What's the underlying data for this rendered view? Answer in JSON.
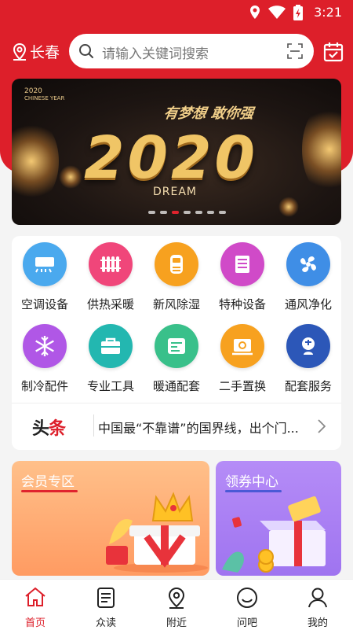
{
  "status": {
    "time": "3:21"
  },
  "header": {
    "location": "长春",
    "search_placeholder": "请输入关键词搜索"
  },
  "banner": {
    "year_tag": "2020",
    "year_sub": "CHINESE YEAR",
    "slogan": "有梦想 敢你强",
    "year_big": "2020",
    "dream": "DREAM",
    "slide_count": 7,
    "active_slide": 3
  },
  "categories": [
    {
      "label": "空调设备",
      "icon": "air-conditioner-icon",
      "color": "#4aa9ee"
    },
    {
      "label": "供热采暖",
      "icon": "radiator-icon",
      "color": "#f0467a"
    },
    {
      "label": "新风除湿",
      "icon": "dehumidifier-icon",
      "color": "#f7a11f"
    },
    {
      "label": "特种设备",
      "icon": "special-equipment-icon",
      "color": "#d04ac8"
    },
    {
      "label": "通风净化",
      "icon": "fan-icon",
      "color": "#3f8ee6"
    },
    {
      "label": "制冷配件",
      "icon": "snowflake-icon",
      "color": "#b057e6"
    },
    {
      "label": "专业工具",
      "icon": "toolbox-icon",
      "color": "#23b7b0"
    },
    {
      "label": "暖通配套",
      "icon": "hvac-kit-icon",
      "color": "#39c08a"
    },
    {
      "label": "二手置换",
      "icon": "exchange-icon",
      "color": "#f7a11f"
    },
    {
      "label": "配套服务",
      "icon": "wrench-service-icon",
      "color": "#2c57b8"
    }
  ],
  "news": {
    "logo_a": "头",
    "logo_b": "条",
    "headline": "中国最“不靠谱”的国界线，出个门..."
  },
  "promos": {
    "member": "会员专区",
    "coupon": "领券中心"
  },
  "tabs": [
    {
      "label": "首页",
      "icon": "home-icon",
      "active": true
    },
    {
      "label": "众读",
      "icon": "reading-icon",
      "active": false
    },
    {
      "label": "附近",
      "icon": "nearby-pin-icon",
      "active": false
    },
    {
      "label": "问吧",
      "icon": "chat-bubble-icon",
      "active": false
    },
    {
      "label": "我的",
      "icon": "profile-icon",
      "active": false
    }
  ],
  "colors": {
    "brand_red": "#dd1f2a"
  }
}
